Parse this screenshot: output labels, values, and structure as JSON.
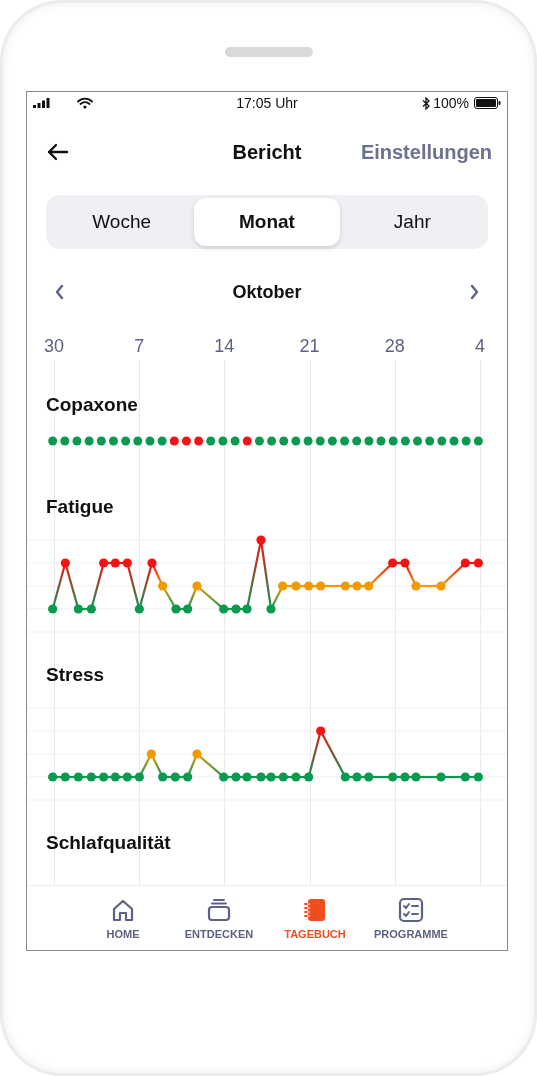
{
  "status_bar": {
    "time": "17:05 Uhr",
    "battery": "100%"
  },
  "header": {
    "title": "Bericht",
    "action": "Einstellungen"
  },
  "period_tabs": [
    {
      "label": "Woche",
      "selected": false
    },
    {
      "label": "Monat",
      "selected": true
    },
    {
      "label": "Jahr",
      "selected": false
    }
  ],
  "month": {
    "label": "Oktober"
  },
  "day_labels": [
    "30",
    "7",
    "14",
    "21",
    "28",
    "4"
  ],
  "sections": [
    {
      "title": "Copaxone",
      "kind": "dots"
    },
    {
      "title": "Fatigue",
      "kind": "line"
    },
    {
      "title": "Stress",
      "kind": "line"
    },
    {
      "title": "Schlafqualität",
      "kind": "title_only"
    }
  ],
  "nav": [
    {
      "label": "HOME",
      "selected": false
    },
    {
      "label": "ENTDECKEN",
      "selected": false
    },
    {
      "label": "TAGEBUCH",
      "selected": true
    },
    {
      "label": "PROGRAMME",
      "selected": false
    }
  ]
}
